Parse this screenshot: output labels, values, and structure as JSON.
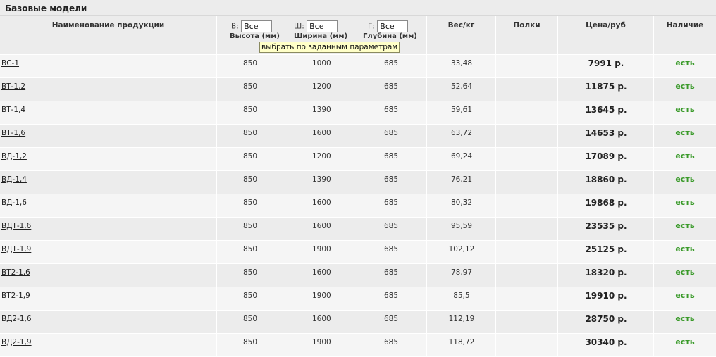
{
  "title": "Базовые модели",
  "header": {
    "name": "Наименование продукции",
    "weight": "Вес/кг",
    "shelves": "Полки",
    "price": "Цена/руб",
    "stock": "Наличие"
  },
  "filters": {
    "height": {
      "prefix": "В:",
      "value": "Все",
      "caption": "Высота (мм)"
    },
    "width": {
      "prefix": "Ш:",
      "value": "Все",
      "caption": "Ширина (мм)"
    },
    "depth": {
      "prefix": "Г:",
      "value": "Все",
      "caption": "Глубина (мм)"
    }
  },
  "tooltip": "выбрать по заданным параметрам",
  "rows": [
    {
      "name": "ВС-1",
      "h": "850",
      "w": "1000",
      "d": "685",
      "weight": "33,48",
      "price": "7991 р.",
      "stock": "есть"
    },
    {
      "name": "ВТ-1,2",
      "h": "850",
      "w": "1200",
      "d": "685",
      "weight": "52,64",
      "price": "11875 р.",
      "stock": "есть"
    },
    {
      "name": "ВТ-1,4",
      "h": "850",
      "w": "1390",
      "d": "685",
      "weight": "59,61",
      "price": "13645 р.",
      "stock": "есть"
    },
    {
      "name": "ВТ-1,6",
      "h": "850",
      "w": "1600",
      "d": "685",
      "weight": "63,72",
      "price": "14653 р.",
      "stock": "есть"
    },
    {
      "name": "ВД-1,2",
      "h": "850",
      "w": "1200",
      "d": "685",
      "weight": "69,24",
      "price": "17089 р.",
      "stock": "есть"
    },
    {
      "name": "ВД-1,4",
      "h": "850",
      "w": "1390",
      "d": "685",
      "weight": "76,21",
      "price": "18860 р.",
      "stock": "есть"
    },
    {
      "name": "ВД-1,6",
      "h": "850",
      "w": "1600",
      "d": "685",
      "weight": "80,32",
      "price": "19868 р.",
      "stock": "есть"
    },
    {
      "name": "ВДТ-1,6",
      "h": "850",
      "w": "1600",
      "d": "685",
      "weight": "95,59",
      "price": "23535 р.",
      "stock": "есть"
    },
    {
      "name": "ВДТ-1,9",
      "h": "850",
      "w": "1900",
      "d": "685",
      "weight": "102,12",
      "price": "25125 р.",
      "stock": "есть"
    },
    {
      "name": "ВТ2-1,6",
      "h": "850",
      "w": "1600",
      "d": "685",
      "weight": "78,97",
      "price": "18320 р.",
      "stock": "есть"
    },
    {
      "name": "ВТ2-1,9",
      "h": "850",
      "w": "1900",
      "d": "685",
      "weight": "85,5",
      "price": "19910 р.",
      "stock": "есть"
    },
    {
      "name": "ВД2-1,6",
      "h": "850",
      "w": "1600",
      "d": "685",
      "weight": "112,19",
      "price": "28750 р.",
      "stock": "есть"
    },
    {
      "name": "ВД2-1,9",
      "h": "850",
      "w": "1900",
      "d": "685",
      "weight": "118,72",
      "price": "30340 р.",
      "stock": "есть"
    }
  ]
}
